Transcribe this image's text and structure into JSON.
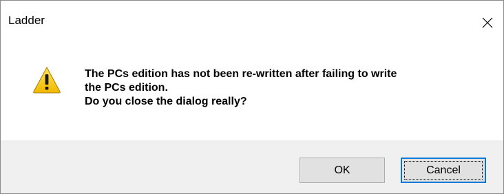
{
  "window": {
    "title": "Ladder",
    "close_icon": "close-x-icon"
  },
  "message": {
    "icon": "warning-triangle-icon",
    "lines": [
      "The PCs edition has not been re-written after failing to write",
      "the PCs edition.",
      "Do you close the dialog really?"
    ]
  },
  "buttons": {
    "ok_label": "OK",
    "cancel_label": "Cancel"
  },
  "colors": {
    "footer_bg": "#f0f0f0",
    "button_bg": "#e1e1e1",
    "focus_border": "#0078d7",
    "warning_yellow": "#f7c800"
  }
}
